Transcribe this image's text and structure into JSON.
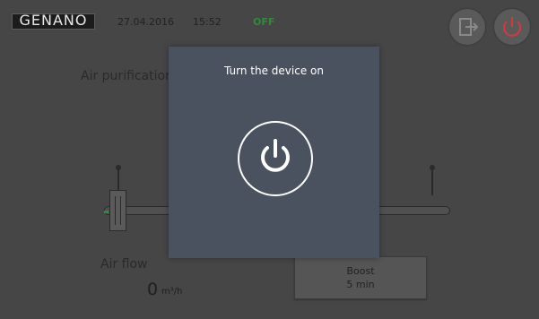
{
  "header": {
    "logo_text": "GENANO",
    "date": "27.04.2016",
    "time": "15:52",
    "status": "OFF",
    "status_color": "#2e8b3a",
    "exit_icon": "exit-icon",
    "power_icon": "power-icon",
    "power_icon_color": "#d23b3b"
  },
  "main": {
    "title": "Air purification",
    "airflow_label": "Air flow",
    "airflow_value": "0",
    "airflow_unit": "m³/h",
    "boost_line1": "Boost",
    "boost_line2": "5 min"
  },
  "modal": {
    "title": "Turn the device on",
    "power_icon": "power-icon"
  }
}
